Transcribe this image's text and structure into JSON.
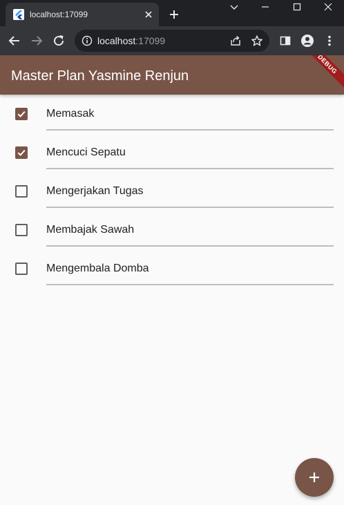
{
  "browser": {
    "tab": {
      "title": "localhost:17099",
      "favicon": "flutter-icon"
    },
    "address": {
      "host": "localhost",
      "port": ":17099"
    }
  },
  "app": {
    "title": "Master Plan Yasmine Renjun",
    "debug_banner": "DEBUG",
    "accent_color": "#795548",
    "tasks": [
      {
        "label": "Memasak",
        "done": true
      },
      {
        "label": "Mencuci Sepatu",
        "done": true
      },
      {
        "label": "Mengerjakan Tugas",
        "done": false
      },
      {
        "label": "Membajak Sawah",
        "done": false
      },
      {
        "label": "Mengembala Domba",
        "done": false
      }
    ],
    "fab_icon": "add-icon"
  }
}
